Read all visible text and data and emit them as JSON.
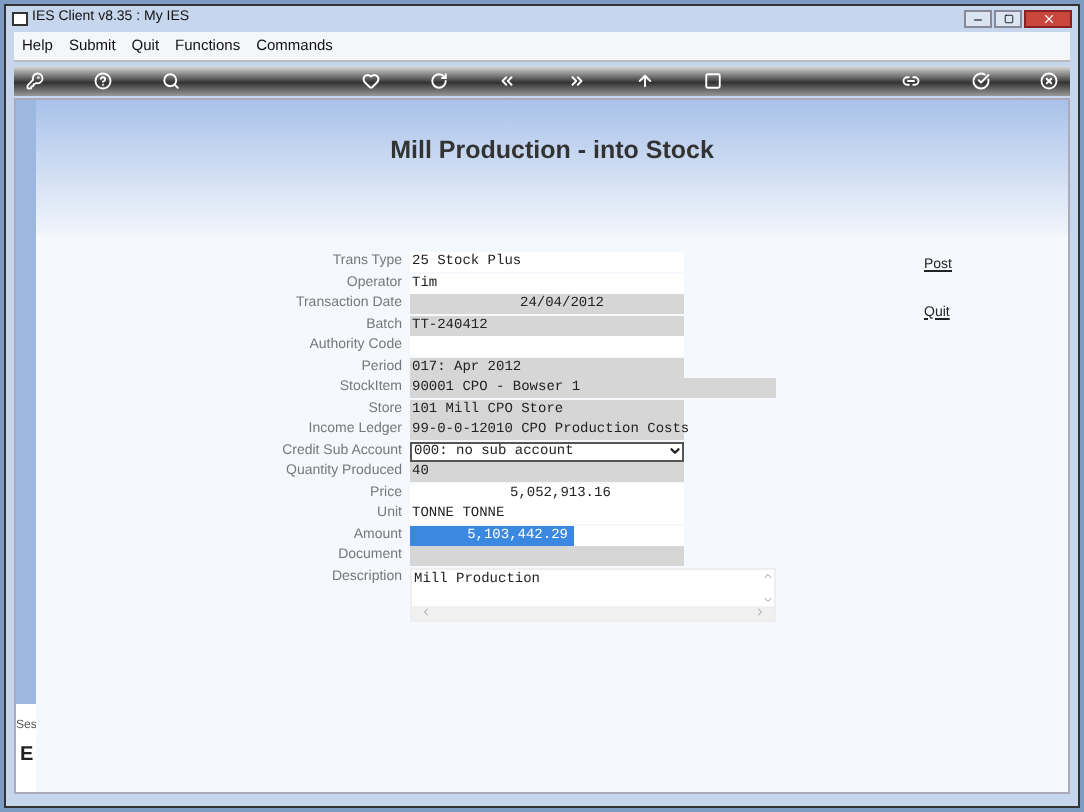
{
  "window": {
    "title": "IES Client v8.35 : My IES"
  },
  "menu": [
    "Help",
    "Submit",
    "Quit",
    "Functions",
    "Commands"
  ],
  "page_title": "Mill Production - into Stock",
  "fields": [
    {
      "label": "Trans Type",
      "kind": "text",
      "shaded": false,
      "value": "25 Stock Plus"
    },
    {
      "label": "Operator",
      "kind": "text",
      "shaded": false,
      "value": "Tim"
    },
    {
      "label": "Transaction Date",
      "kind": "date",
      "shaded": true,
      "value": "24/04/2012"
    },
    {
      "label": "Batch",
      "kind": "text",
      "shaded": true,
      "value": "TT-240412"
    },
    {
      "label": "Authority Code",
      "kind": "text",
      "shaded": false
    },
    {
      "label": "Period",
      "kind": "text",
      "shaded": true,
      "value": "017: Apr 2012"
    },
    {
      "label": "StockItem",
      "kind": "wide",
      "shaded": true,
      "value": "90001 CPO - Bowser 1"
    },
    {
      "label": "Store",
      "kind": "text",
      "shaded": true,
      "value": "101 Mill CPO Store"
    },
    {
      "label": "Income Ledger",
      "kind": "text",
      "shaded": true,
      "value": "99-0-0-12010 CPO Production Costs"
    },
    {
      "label": "Credit Sub Account",
      "kind": "dropdown",
      "shaded": false,
      "value": "000: no sub account"
    },
    {
      "label": "Quantity Produced",
      "kind": "text",
      "shaded": true,
      "value": "40"
    },
    {
      "label": "Price",
      "kind": "number",
      "shaded": false,
      "value": "5,052,913.16"
    },
    {
      "label": "Unit",
      "kind": "text",
      "shaded": false,
      "value": "TONNE TONNE"
    },
    {
      "label": "Amount",
      "kind": "amount",
      "shaded": false,
      "selected": true,
      "value": "5,103,442.29"
    },
    {
      "label": "Document",
      "kind": "text",
      "shaded": true
    },
    {
      "label": "Description",
      "kind": "memo",
      "shaded": false,
      "value": "Mill Production"
    }
  ],
  "actions": [
    "Post",
    "Quit"
  ],
  "sidebar": {
    "label": "Ses",
    "letter": "E"
  }
}
